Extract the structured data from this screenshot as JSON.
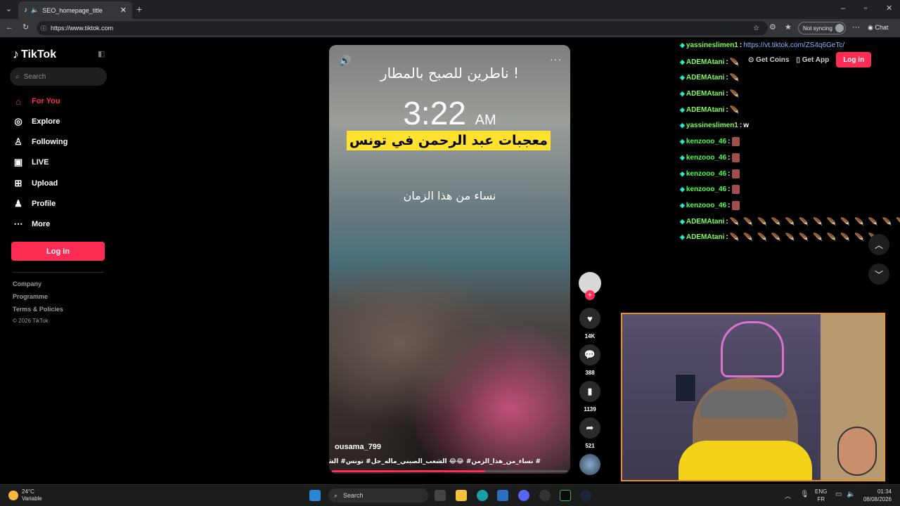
{
  "browser": {
    "tab_title": "SEO_homepage_title",
    "url": "https://www.tiktok.com",
    "sync_label": "Not syncing",
    "chat_label": "Chat"
  },
  "sidebar": {
    "logo": "TikTok",
    "search_placeholder": "Search",
    "nav": [
      {
        "label": "For You",
        "icon": "home-icon",
        "active": true
      },
      {
        "label": "Explore",
        "icon": "compass-icon"
      },
      {
        "label": "Following",
        "icon": "user-follow-icon"
      },
      {
        "label": "LIVE",
        "icon": "live-icon"
      },
      {
        "label": "Upload",
        "icon": "upload-icon"
      },
      {
        "label": "Profile",
        "icon": "profile-icon"
      },
      {
        "label": "More",
        "icon": "more-icon"
      }
    ],
    "login": "Log in",
    "footer": [
      "Company",
      "Programme",
      "Terms & Policies",
      "© 2026 TikTok"
    ]
  },
  "video": {
    "overlay_line1": "ناطرين للصبح بالمطار !",
    "clock": "3:22",
    "clock_suffix": "AM",
    "headline": "معجبات عبد الرحمن في تونس",
    "overlay_line2": "نساء من هذا الزمان",
    "username": "ousama_799",
    "hashtags": "# نساء_من_هذا_الزمن# 😂😂 الشعب_الصيني_ماله_حل# تونس# الشامي#",
    "progress": 0.65
  },
  "actions": {
    "likes": "14K",
    "comments": "388",
    "saves": "1139",
    "shares": "521"
  },
  "top_right": {
    "get_coins": "Get Coins",
    "get_app": "Get App",
    "login": "Log in"
  },
  "chat": [
    {
      "user": "yassineslimen1",
      "text": "https://vt.tiktok.com/ZS4q6GeTc/",
      "type": "link"
    },
    {
      "user": "ADEMAtani",
      "feathers": 1
    },
    {
      "user": "ADEMAtani",
      "feathers": 1
    },
    {
      "user": "ADEMAtani",
      "feathers": 1
    },
    {
      "user": "ADEMAtani",
      "feathers": 1
    },
    {
      "user": "yassineslimen1",
      "text": "w",
      "type": "text"
    },
    {
      "user": "kenzooo_46",
      "emoji": 1
    },
    {
      "user": "kenzooo_46",
      "emoji": 1
    },
    {
      "user": "kenzooo_46",
      "emoji": 1
    },
    {
      "user": "kenzooo_46",
      "emoji": 1
    },
    {
      "user": "kenzooo_46",
      "emoji": 1
    },
    {
      "user": "ADEMAtani",
      "feathers": 13
    },
    {
      "user": "ADEMAtani",
      "feathers": 11
    }
  ],
  "taskbar": {
    "temp": "24°C",
    "weather": "Variable",
    "search": "Search",
    "lang1": "ENG",
    "lang2": "FR",
    "time": "01:34",
    "date": "08/08/2026"
  },
  "colors": {
    "accent": "#fe2c55",
    "chat_name": "#7dff55",
    "link": "#8bb4ff"
  }
}
